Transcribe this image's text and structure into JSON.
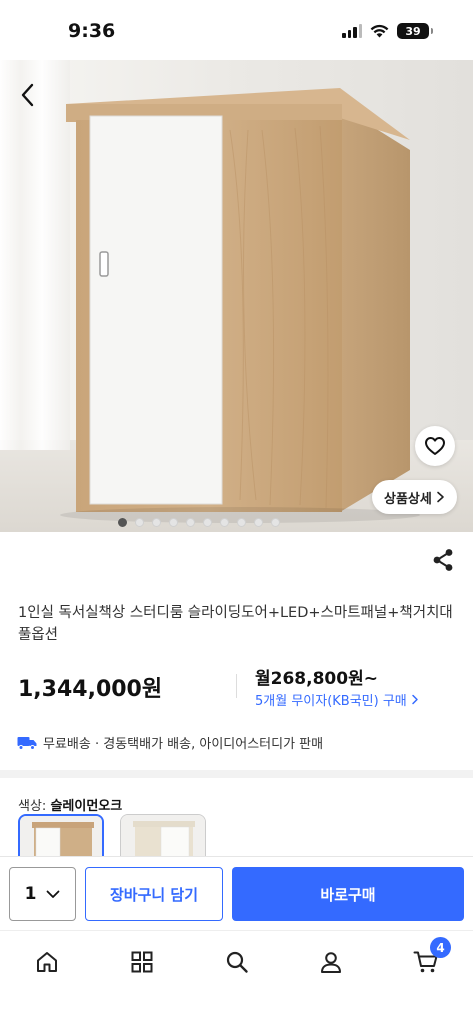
{
  "status_bar": {
    "time": "9:36",
    "battery": "39"
  },
  "product": {
    "title": "1인실 독서실책상 스터디룸 슬라이딩도어+LED+스마트패널+책거치대 풀옵션",
    "price": "1,344,000원",
    "monthly_price": "월268,800원~",
    "installment": "5개월 무이자(KB국민) 구매",
    "shipping": "무료배송 · 경동택배가 배송, 아이디어스터디가 판매",
    "detail_button": "상품상세",
    "image_count": 10,
    "active_image_index": 0
  },
  "options": {
    "color_label": "색상:",
    "color_value": "슬레이먼오크"
  },
  "purchase_bar": {
    "quantity": "1",
    "cart_label": "장바구니 담기",
    "buy_label": "바로구매"
  },
  "tab_bar": {
    "cart_badge": "4",
    "items": [
      "home-icon",
      "category-icon",
      "search-icon",
      "my-page-icon",
      "cart-icon"
    ]
  },
  "colors": {
    "accent": "#346aff",
    "text": "#111111",
    "sub_text": "#333333"
  }
}
